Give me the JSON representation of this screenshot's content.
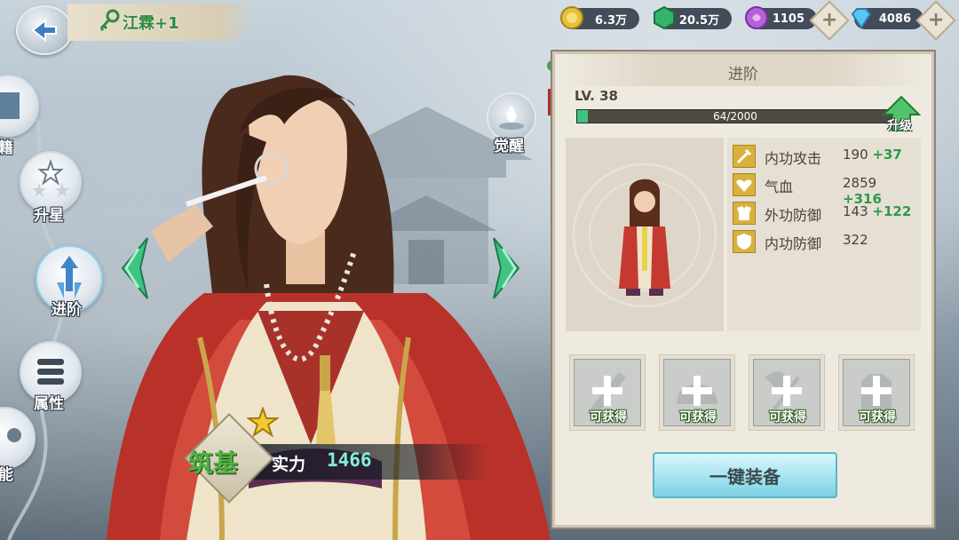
{
  "header": {
    "name": "江霖+1",
    "resources": [
      {
        "icon": "gold-coin-icon",
        "value": "6.3万",
        "color": "#e6c23a"
      },
      {
        "icon": "jade-icon",
        "value": "20.5万",
        "color": "#35b56c"
      },
      {
        "icon": "purple-crystal-icon",
        "value": "1105",
        "color": "#b560d8"
      },
      {
        "icon": "diamond-icon",
        "value": "4086",
        "color": "#5cc4f2"
      }
    ]
  },
  "nav": {
    "items": [
      {
        "label": "籍"
      },
      {
        "label": "升星"
      },
      {
        "label": "进阶"
      },
      {
        "label": "属性"
      },
      {
        "label": "能"
      }
    ]
  },
  "awaken": {
    "label": "觉醒"
  },
  "hero": {
    "realm": "筑基",
    "power_label": "实力",
    "power_value": "1466"
  },
  "panel": {
    "title": "进阶",
    "level": "LV. 38",
    "exp_text": "64/2000",
    "exp_fraction": 0.032,
    "upgrade_label": "升级",
    "stats": [
      {
        "icon": "sword-icon",
        "name": "内功攻击",
        "value": "190",
        "bonus": "+37"
      },
      {
        "icon": "heart-icon",
        "name": "气血",
        "value": "2859",
        "bonus": "+316"
      },
      {
        "icon": "armor-icon",
        "name": "外功防御",
        "value": "143",
        "bonus": "+122"
      },
      {
        "icon": "shield-icon",
        "name": "内功防御",
        "value": "322",
        "bonus": ""
      }
    ],
    "equip_slots": [
      {
        "label": "可获得",
        "icon": "sword-slot-icon"
      },
      {
        "label": "可获得",
        "icon": "helmet-slot-icon"
      },
      {
        "label": "可获得",
        "icon": "axe-slot-icon"
      },
      {
        "label": "可获得",
        "icon": "gloves-slot-icon"
      }
    ],
    "one_key_equip": "一键装备"
  }
}
